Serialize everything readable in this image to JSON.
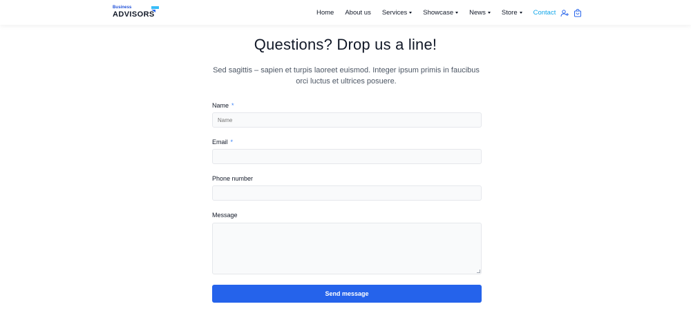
{
  "brand": {
    "small": "Business",
    "big": "ADVISORS",
    "accent": "#2563eb",
    "flag_color": "#38bdf8"
  },
  "nav": {
    "items": [
      {
        "label": "Home",
        "dropdown": false
      },
      {
        "label": "About us",
        "dropdown": false
      },
      {
        "label": "Services",
        "dropdown": true
      },
      {
        "label": "Showcase",
        "dropdown": true
      },
      {
        "label": "News",
        "dropdown": true
      },
      {
        "label": "Store",
        "dropdown": true
      },
      {
        "label": "Contact",
        "dropdown": false,
        "active": true
      }
    ],
    "active_color": "#0ea5e9",
    "icons": [
      "user-plus-icon",
      "shopping-bag-icon"
    ]
  },
  "main": {
    "title": "Questions? Drop us a line!",
    "lead": "Sed sagittis – sapien et turpis laoreet euismod. Integer ipsum primis in faucibus orci luctus et ultrices posuere."
  },
  "form": {
    "name_label": "Name",
    "name_placeholder": "Name",
    "email_label": "Email",
    "phone_label": "Phone number",
    "message_label": "Message",
    "required_marker": "*",
    "submit_label": "Send message"
  }
}
